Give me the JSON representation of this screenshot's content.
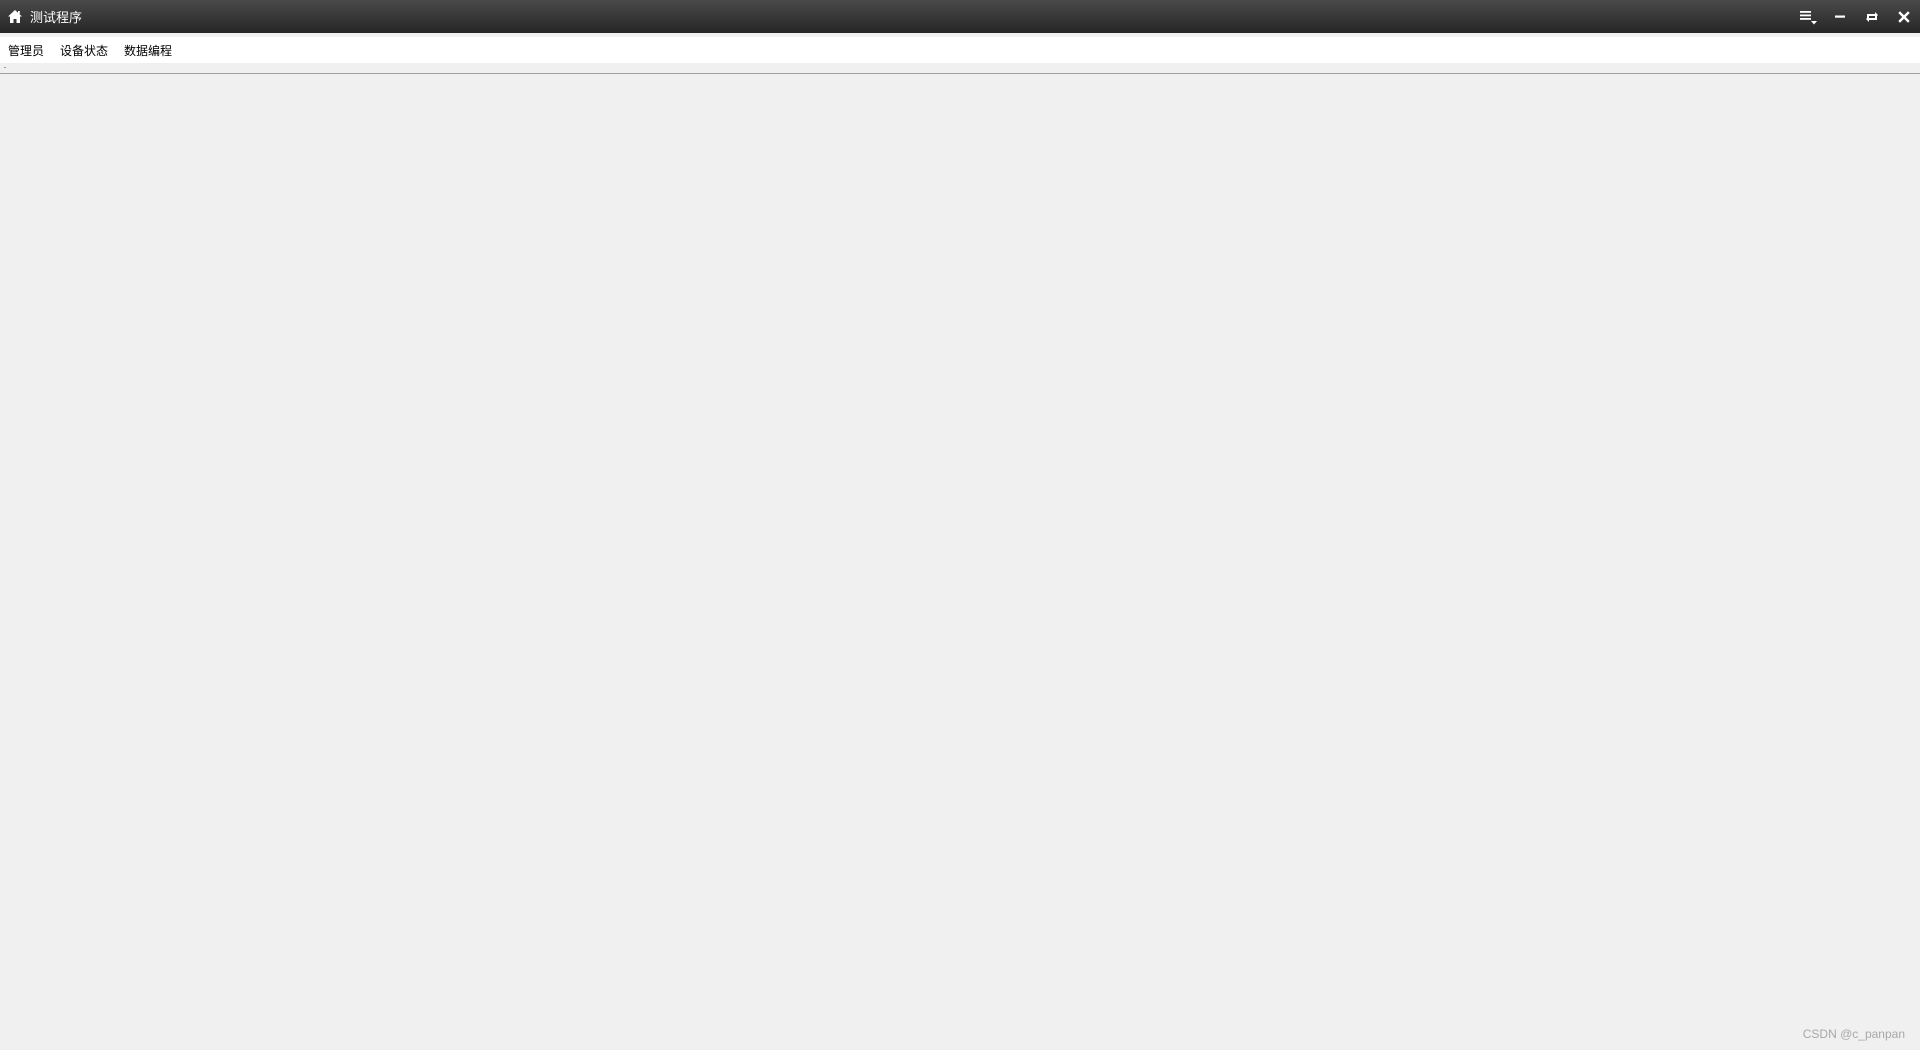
{
  "window": {
    "title": "测试程序",
    "icons": {
      "app": "home-icon",
      "menu": "hamburger-menu-icon",
      "minimize": "minimize-icon",
      "restore": "restore-icon",
      "close": "close-icon"
    },
    "colors": {
      "titlebar": "#2f2f2f",
      "background": "#f0f0f0",
      "menubar": "#ffffff"
    }
  },
  "menubar": {
    "items": [
      {
        "label": "管理员"
      },
      {
        "label": "设备状态"
      },
      {
        "label": "数据编程"
      }
    ]
  },
  "watermark": {
    "text": "CSDN @c_panpan"
  }
}
